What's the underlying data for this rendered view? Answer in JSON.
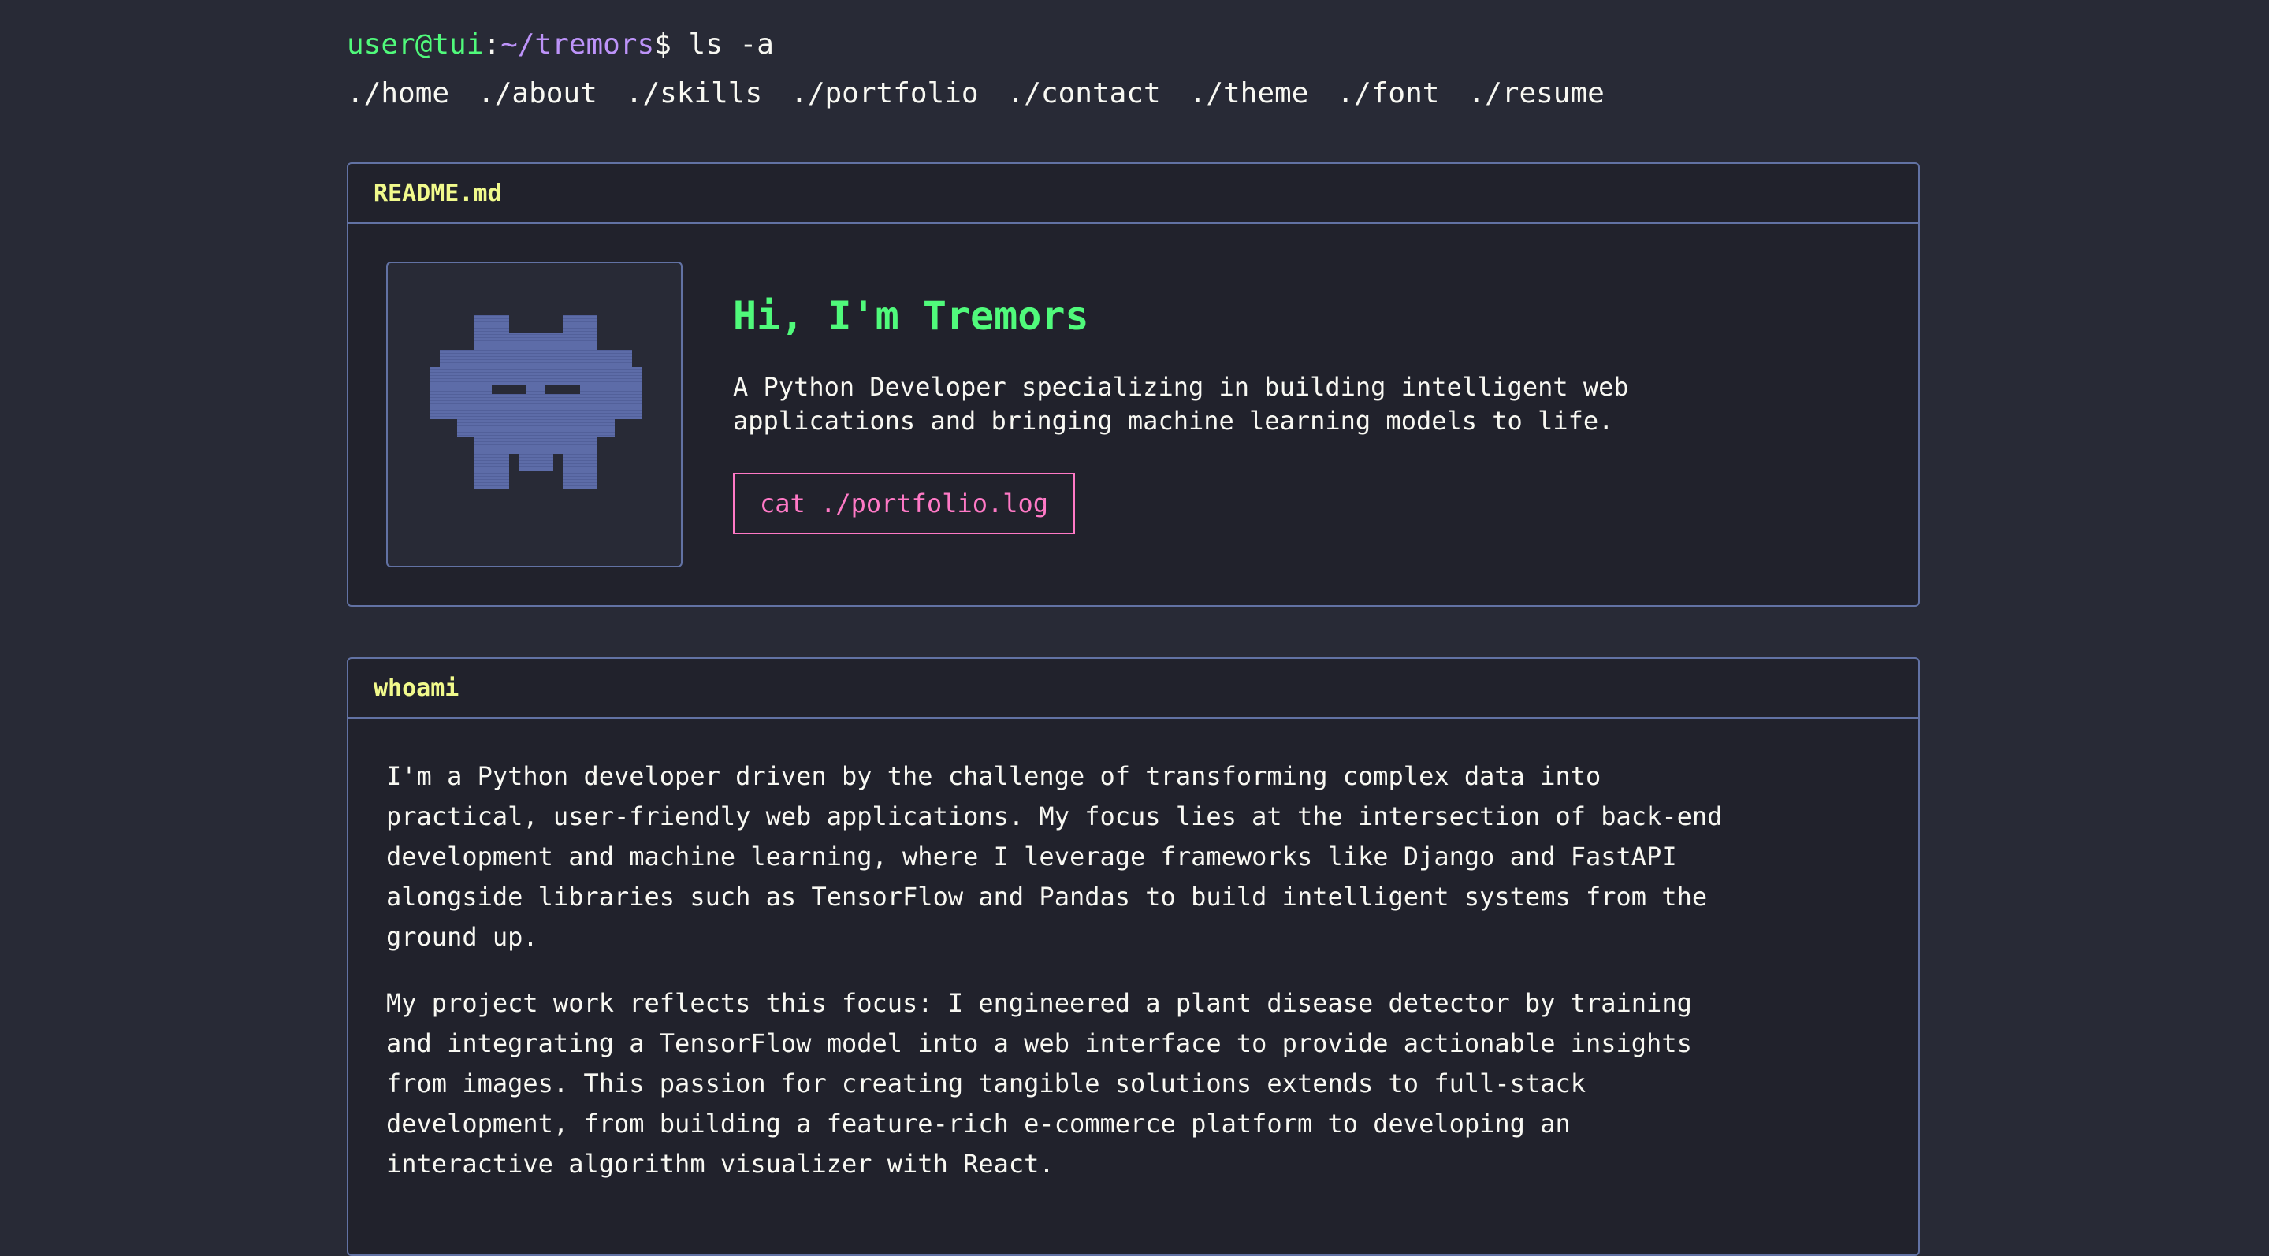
{
  "prompt": {
    "user": "user@tui",
    "colon": ":",
    "path": "~/tremors",
    "dollar": "$",
    "command": " ls -a"
  },
  "nav": {
    "items": [
      {
        "label": "./home"
      },
      {
        "label": "./about"
      },
      {
        "label": "./skills"
      },
      {
        "label": "./portfolio"
      },
      {
        "label": "./contact"
      },
      {
        "label": "./theme"
      },
      {
        "label": "./font"
      },
      {
        "label": "./resume"
      }
    ]
  },
  "readme": {
    "header": "README.md",
    "avatar_icon": "space-invader-icon",
    "title": "Hi, I'm Tremors",
    "description": "A Python Developer specializing in building intelligent web applications and bringing machine learning models to life.",
    "button_label": "cat ./portfolio.log"
  },
  "whoami": {
    "header": "whoami",
    "paragraphs": [
      "I'm a Python developer driven by the challenge of transforming complex data into practical, user-friendly web applications. My focus lies at the intersection of back-end development and machine learning, where I leverage frameworks like Django and FastAPI alongside libraries such as TensorFlow and Pandas to build intelligent systems from the ground up.",
      "My project work reflects this focus: I engineered a plant disease detector by training and integrating a TensorFlow model into a web interface to provide actionable insights from images. This passion for creating tangible solutions extends to full-stack development, from building a feature-rich e-commerce platform to developing an interactive algorithm visualizer with React."
    ]
  },
  "colors": {
    "background": "#282a36",
    "panel": "#21222c",
    "border": "#6272a4",
    "green": "#50fa7b",
    "purple": "#bd93f9",
    "yellow": "#f1fa8c",
    "pink": "#ff79c6",
    "avatar": "#5d6ca8"
  }
}
